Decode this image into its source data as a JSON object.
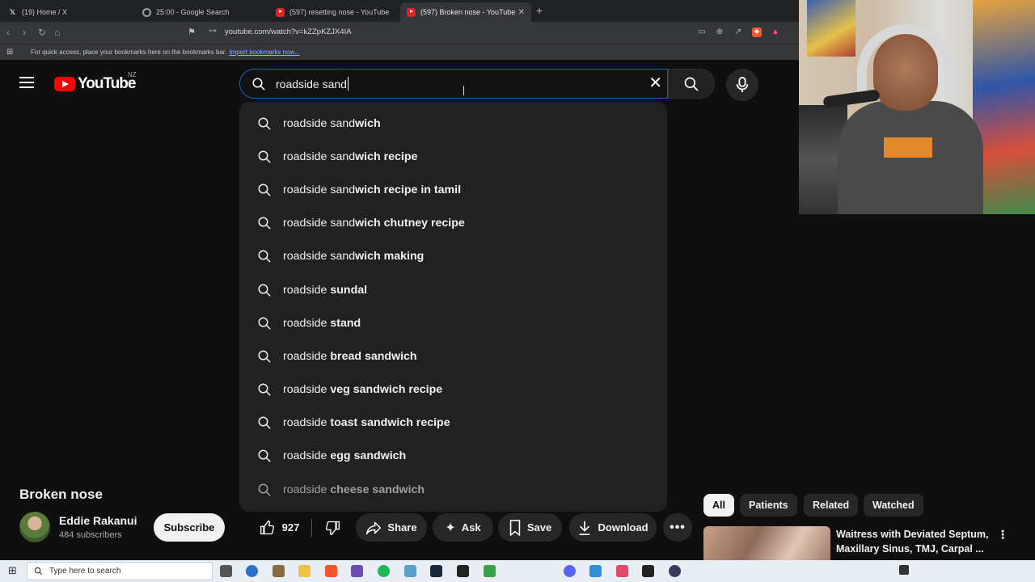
{
  "browser": {
    "tabs": [
      {
        "title": "(19) Home / X",
        "icon": "x-logo-icon"
      },
      {
        "title": "25:00 - Google Search",
        "icon": "google-icon"
      },
      {
        "title": "(597) resetting nose - YouTube",
        "icon": "youtube-icon"
      },
      {
        "title": "(597) Broken nose - YouTube",
        "icon": "youtube-icon",
        "active": true
      }
    ],
    "url": "youtube.com/watch?v=kZZpKZJX4IA",
    "bookmarks_hint": "For quick access, place your bookmarks here on the bookmarks bar.",
    "import_link": "Import bookmarks now..."
  },
  "youtube": {
    "logo_text": "YouTube",
    "region": "NZ",
    "search": {
      "query": "roadside sand",
      "suggestions": [
        {
          "prefix": "roadside sand",
          "completion": "wich"
        },
        {
          "prefix": "roadside sand",
          "completion": "wich recipe"
        },
        {
          "prefix": "roadside sand",
          "completion": "wich recipe in tamil"
        },
        {
          "prefix": "roadside sand",
          "completion": "wich chutney recipe"
        },
        {
          "prefix": "roadside sand",
          "completion": "wich making"
        },
        {
          "prefix": "roadside ",
          "completion": "sundal"
        },
        {
          "prefix": "roadside ",
          "completion": "stand"
        },
        {
          "prefix": "roadside ",
          "completion": "bread sandwich"
        },
        {
          "prefix": "roadside ",
          "completion": "veg sandwich recipe"
        },
        {
          "prefix": "roadside ",
          "completion": "toast sandwich recipe"
        },
        {
          "prefix": "roadside ",
          "completion": "egg sandwich"
        },
        {
          "prefix": "roadside ",
          "completion": "cheese sandwich"
        }
      ]
    },
    "video": {
      "title": "Broken nose",
      "channel": "Eddie Rakanui",
      "subscribers": "484 subscribers",
      "subscribe_label": "Subscribe",
      "likes": "927",
      "share_label": "Share",
      "ask_label": "Ask",
      "save_label": "Save",
      "download_label": "Download"
    },
    "chips": [
      "All",
      "Patients",
      "Related",
      "Watched"
    ],
    "recommendation": {
      "title": "Waitress with Deviated Septum, Maxillary Sinus, TMJ, Carpal ..."
    }
  },
  "taskbar": {
    "search_placeholder": "Type here to search"
  },
  "colors": {
    "accent_blue": "#1c62b9",
    "youtube_red": "#ff0000",
    "background": "#0f0f0f"
  }
}
